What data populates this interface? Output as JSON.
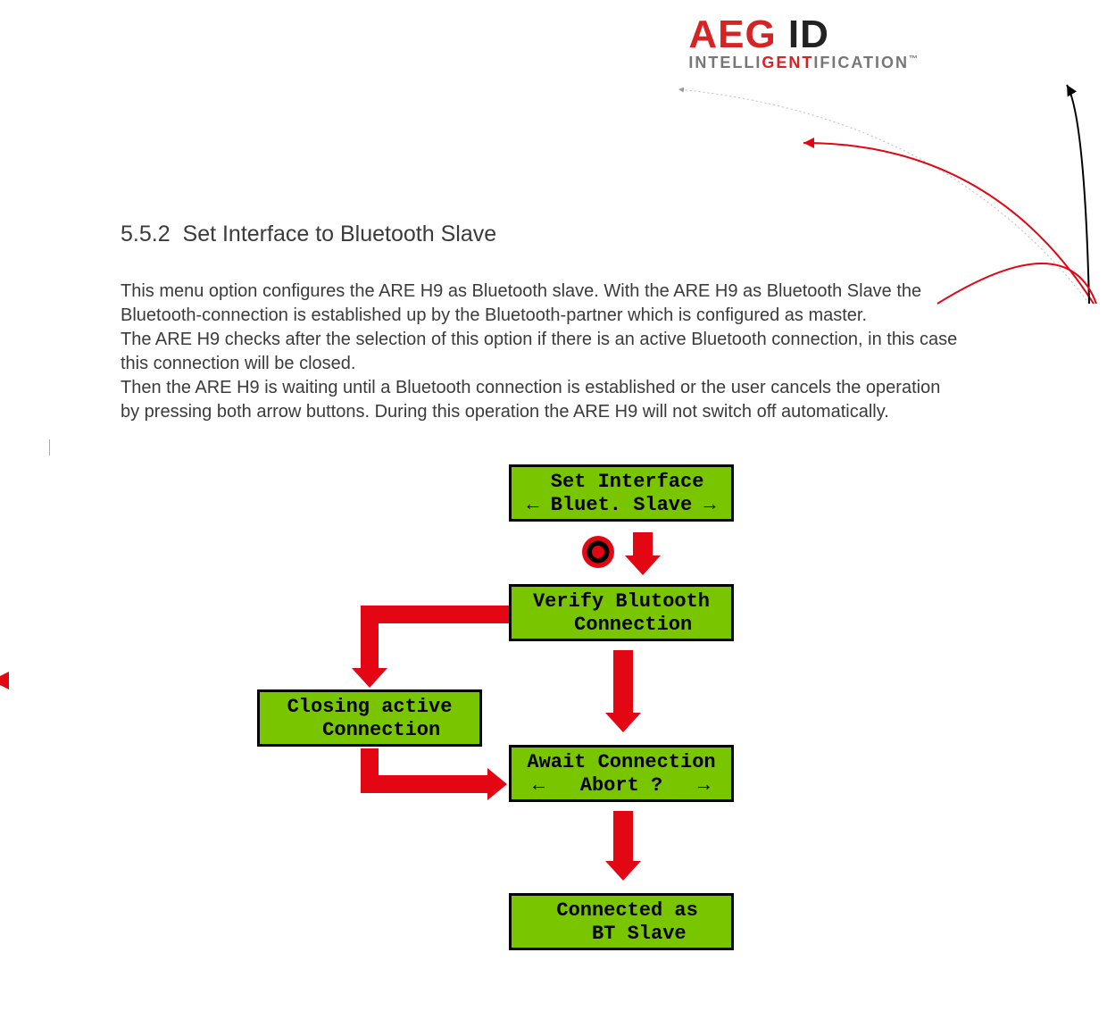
{
  "logo": {
    "brand_left": "AEG",
    "brand_right": " ID",
    "tag_prefix": "INTELLI",
    "tag_blend": "GENT",
    "tag_suffix": "IFICATION",
    "tm": "™"
  },
  "section": {
    "number": "5.5.2",
    "title": "Set Interface to Bluetooth Slave"
  },
  "paragraphs": {
    "p1": "This menu option configures the ARE H9 as Bluetooth slave. With the ARE H9 as Bluetooth Slave the Bluetooth-connection is established up by the Bluetooth-partner which is configured as master.",
    "p2": "The ARE H9 checks after the selection of this option if there is an active Bluetooth connection, in this case this connection will be closed.",
    "p3": "Then the ARE H9 is waiting until a Bluetooth connection is established or the user cancels the operation by pressing both arrow buttons. During this operation the ARE H9 will not switch off automatically."
  },
  "lcd": {
    "set_interface": {
      "l1": " Set Interface",
      "l2": "← Bluet. Slave →"
    },
    "verify": {
      "l1": "Verify Blutooth",
      "l2": "  Connection"
    },
    "closing": {
      "l1": "Closing active",
      "l2": "  Connection"
    },
    "await": {
      "l1": "Await Connection",
      "l2": "←   Abort ?   →"
    },
    "connected": {
      "l1": " Connected as",
      "l2": "   BT Slave"
    }
  },
  "icons": {
    "press_button": "press-button-icon"
  },
  "colors": {
    "accent_red": "#e30613",
    "lcd_green": "#79c600"
  }
}
